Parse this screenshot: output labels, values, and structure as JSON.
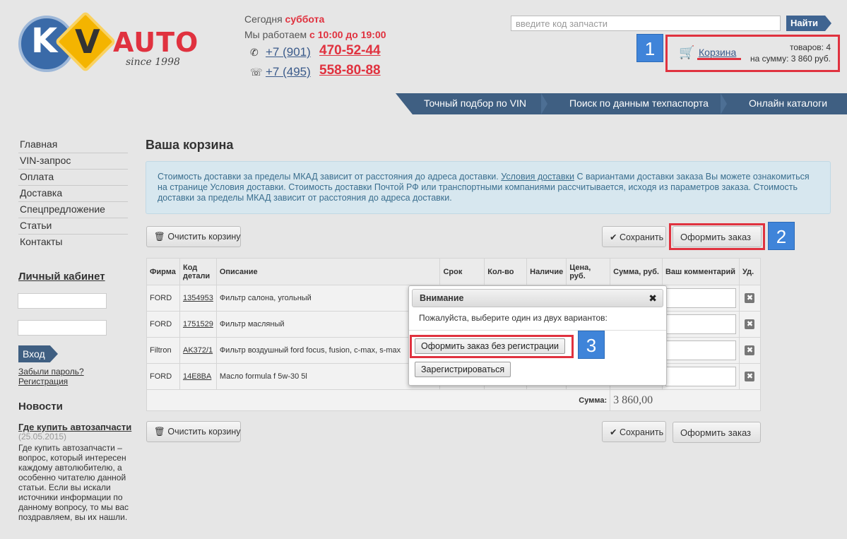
{
  "header": {
    "logo_k": "K",
    "logo_v": "V",
    "logo_auto": "AUTO",
    "logo_since": "since 1998",
    "today_label": "Сегодня",
    "today_day": "суббота",
    "hours_label": "Мы работаем",
    "hours_value": "с 10:00 до 19:00",
    "phone1_prefix": "+7 (901)",
    "phone1_number": "470-52-44",
    "phone2_prefix": "+7 (495)",
    "phone2_number": "558-80-88",
    "search_placeholder": "введите код запчасти",
    "search_button": "Найти",
    "cart_link": "Корзина",
    "cart_count": "товаров: 4",
    "cart_sum": "на сумму: 3 860 руб."
  },
  "badges": [
    "1",
    "2",
    "3"
  ],
  "topnav": [
    "Точный подбор по VIN",
    "Поиск по данным техпаспорта",
    "Онлайн каталоги"
  ],
  "sidebar": {
    "items": [
      "Главная",
      "VIN-запрос",
      "Оплата",
      "Доставка",
      "Спецпредложение",
      "Статьи",
      "Контакты"
    ],
    "cabinet_title": "Личный кабинет",
    "login_button": "Вход",
    "forgot_link": "Забыли пароль?",
    "register_link": "Регистрация",
    "news_title": "Новости",
    "news_head": "Где купить автозапчасти",
    "news_date": "(25.05.2015)",
    "news_text": "Где купить автозапчасти – вопрос, который интересен каждому автолюбителю, а особенно читателю данной статьи. Если вы искали источники информации по данному вопросу, то мы вас поздравляем, вы их нашли."
  },
  "main": {
    "title": "Ваша корзина",
    "info_part1": "Стоимость доставки за пределы МКАД зависит от расстояния до адреса доставки.",
    "info_link": "Условия доставки",
    "info_part2": "С вариантами доставки заказа Вы можете ознакомиться на странице Условия доставки. Стоимость доставки Почтой РФ или транспортными компаниями рассчитывается, исходя из параметров заказа. Стоимость доставки за пределы МКАД зависит от расстояния до адреса доставки.",
    "clear_button": "Очистить корзину",
    "save_button": "Сохранить",
    "order_button": "Оформить заказ"
  },
  "table": {
    "headers": [
      "Фирма",
      "Код детали",
      "Описание",
      "Срок",
      "Кол-во",
      "Наличие",
      "Цена, руб.",
      "Сумма, руб.",
      "Ваш комментарий",
      "Уд."
    ],
    "rows": [
      {
        "brand": "FORD",
        "code": "1354953",
        "desc": "Фильтр салона, угольный"
      },
      {
        "brand": "FORD",
        "code": "1751529",
        "desc": "Фильтр масляный"
      },
      {
        "brand": "Filtron",
        "code": "AK372/1",
        "desc": "Фильтр воздушный ford focus, fusion, c-max, s-max"
      },
      {
        "brand": "FORD",
        "code": "14E8BA",
        "desc": "Масло formula f 5w-30 5l"
      }
    ],
    "sum_label": "Сумма:",
    "sum_value": "3 860,00"
  },
  "dialog": {
    "title": "Внимание",
    "close": "✖",
    "message": "Пожалуйста, выберите один из двух вариантов:",
    "no_register_button": "Оформить заказ без регистрации",
    "register_button": "Зарегистрироваться"
  },
  "colors": {
    "accent_red": "#e0323f",
    "nav_blue": "#3f5f82",
    "badge_blue": "#3f84d9"
  }
}
